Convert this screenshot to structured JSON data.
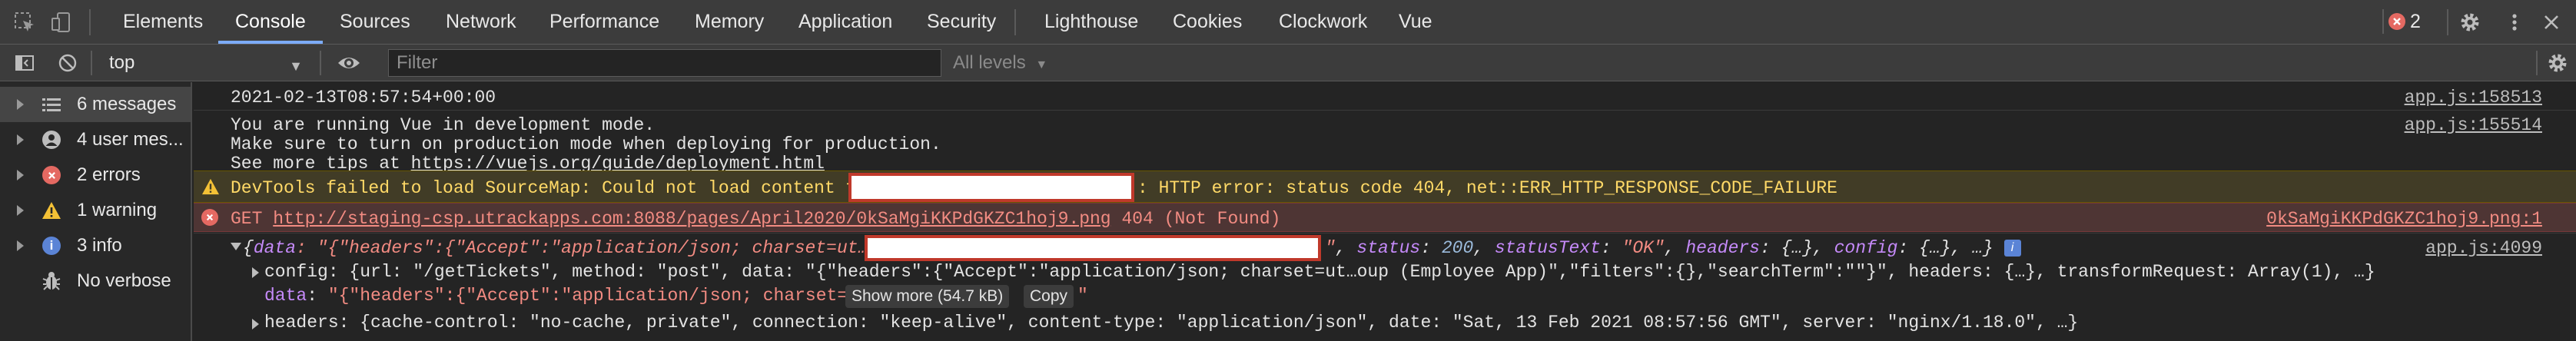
{
  "tabs": {
    "items": [
      "Elements",
      "Console",
      "Sources",
      "Network",
      "Performance",
      "Memory",
      "Application",
      "Security",
      "Lighthouse",
      "Cookies",
      "Clockwork",
      "Vue"
    ],
    "active": "Console"
  },
  "tabbar_right": {
    "error_count": "2"
  },
  "toolbar": {
    "context": "top",
    "filter_placeholder": "Filter",
    "levels_label": "All levels"
  },
  "sidebar": {
    "items": [
      {
        "icon": "list-icon",
        "label": "6 messages",
        "selected": true
      },
      {
        "icon": "user-icon",
        "label": "4 user mes..."
      },
      {
        "icon": "error-icon",
        "label": "2 errors"
      },
      {
        "icon": "warning-icon",
        "label": "1 warning"
      },
      {
        "icon": "info-icon",
        "label": "3 info"
      },
      {
        "icon": "bug-icon",
        "label": "No verbose"
      }
    ]
  },
  "console": {
    "timestamp": {
      "text": "2021-02-13T08:57:54+00:00",
      "source": "app.js:158513"
    },
    "vue_dev": {
      "line1": "You are running Vue in development mode.",
      "line2": "Make sure to turn on production mode when deploying for production.",
      "line3_prefix": "See more tips at ",
      "line3_link": "https://vuejs.org/guide/deployment.html",
      "source": "app.js:155514"
    },
    "warning": {
      "prefix": "DevTools failed to load SourceMap: Could not load content for",
      "suffix": ": HTTP error: status code 404, net::ERR_HTTP_RESPONSE_CODE_FAILURE"
    },
    "error": {
      "method": "GET",
      "url": "http://staging-csp.utrackapps.com:8088/pages/April2020/0kSaMgiKKPdGKZC1hoj9.png",
      "status": "404 (Not Found)",
      "source": "0kSaMgiKKPdGKZC1hoj9.png:1"
    },
    "object_log": {
      "head_open": "{",
      "data_key": "data",
      "data_prefix": ": \"{\"headers\":{\"Accept\":\"application/json; charset=ut…\"",
      "data_slash": "/",
      "after_redact_quote": "\"",
      "status_key": "status",
      "status_val": "200",
      "statusText_key": "statusText",
      "statusText_val": "\"OK\"",
      "headers_key": "headers",
      "headers_val": "{…}",
      "config_key": "config",
      "config_val": "{…}",
      "tail": "…}",
      "source": "app.js:4099",
      "config_line": "config: {url: \"/getTickets\", method: \"post\", data: \"{\"headers\":{\"Accept\":\"application/json; charset=ut…oup (Employee App)\",\"filters\":{},\"searchTerm\":\"\"}\", headers: {…}, transformRequest: Array(1), …}",
      "data_line_key": "data",
      "data_line_val": "\"{\"headers\":{\"Accept\":\"application/json; charset=ut",
      "show_more": "Show more (54.7 kB)",
      "copy": "Copy",
      "data_line_end": "\"",
      "headers_line": "headers: {cache-control: \"no-cache, private\", connection: \"keep-alive\", content-type: \"application/json\", date: \"Sat, 13 Feb 2021 08:57:56 GMT\", server: \"nginx/1.18.0\", …}"
    }
  }
}
